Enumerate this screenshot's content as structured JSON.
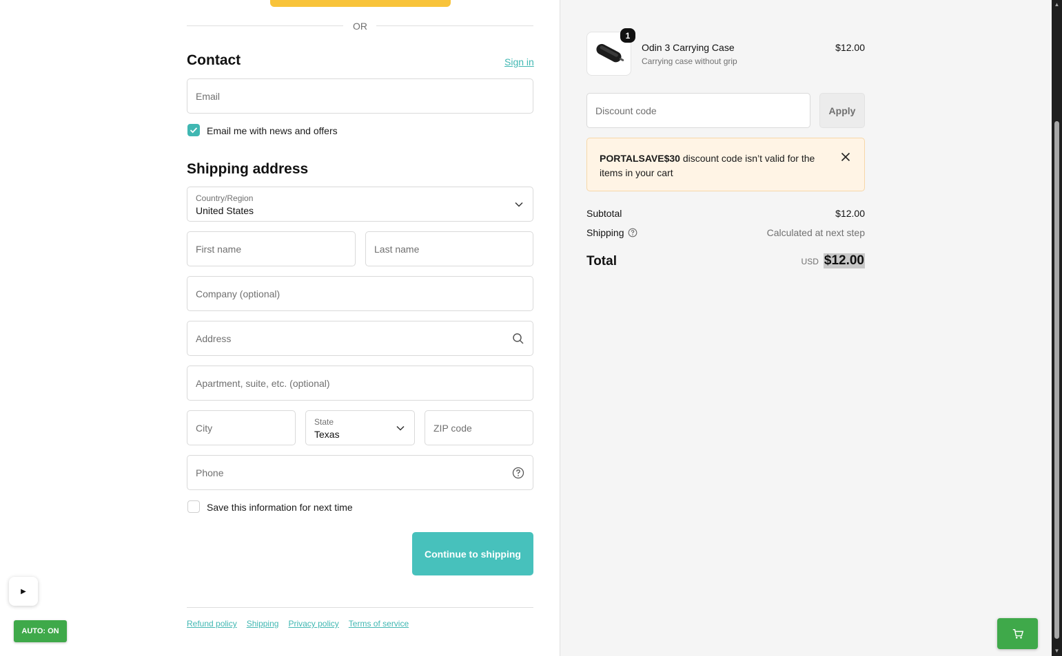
{
  "express": {
    "or_label": "OR"
  },
  "contact": {
    "title": "Contact",
    "sign_in": "Sign in",
    "email_placeholder": "Email",
    "news_label": "Email me with news and offers",
    "news_checked": true
  },
  "shipping": {
    "title": "Shipping address",
    "country_label": "Country/Region",
    "country_value": "United States",
    "first_name_placeholder": "First name",
    "last_name_placeholder": "Last name",
    "company_placeholder": "Company (optional)",
    "address_placeholder": "Address",
    "apartment_placeholder": "Apartment, suite, etc. (optional)",
    "city_placeholder": "City",
    "state_label": "State",
    "state_value": "Texas",
    "zip_placeholder": "ZIP code",
    "phone_placeholder": "Phone",
    "save_label": "Save this information for next time",
    "save_checked": false,
    "continue_label": "Continue to shipping"
  },
  "footer": {
    "links": [
      "Refund policy",
      "Shipping",
      "Privacy policy",
      "Terms of service"
    ]
  },
  "overlay": {
    "play_glyph": "▶",
    "auto_label": "AUTO: ON"
  },
  "summary": {
    "item": {
      "quantity": "1",
      "name": "Odin 3 Carrying Case",
      "variant": "Carrying case without grip",
      "price": "$12.00"
    },
    "discount_placeholder": "Discount code",
    "apply_label": "Apply",
    "alert": {
      "code": "PORTALSAVE$30",
      "message": " discount code isn’t valid for the items in your cart"
    },
    "subtotal_label": "Subtotal",
    "subtotal_value": "$12.00",
    "shipping_label": "Shipping",
    "shipping_value": "Calculated at next step",
    "total_label": "Total",
    "currency": "USD",
    "total_value": "$12.00"
  },
  "colors": {
    "accent": "#40b7b2",
    "express_pay": "#f8c33a",
    "alert_bg": "#fff4e5",
    "overlay_green": "#3fa94a"
  }
}
